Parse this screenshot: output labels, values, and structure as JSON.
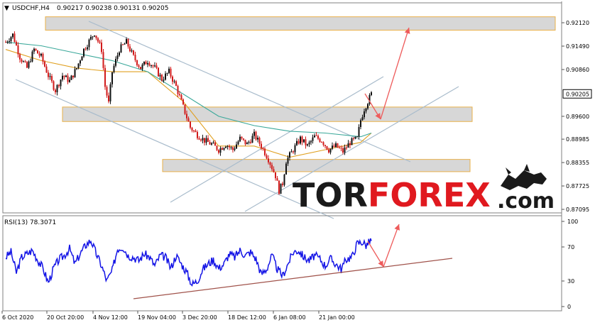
{
  "header": {
    "symbol": "USDCHF,H4",
    "ohlc": "0.90217 0.90238 0.90131 0.90205"
  },
  "watermark": {
    "part1": "TOR",
    "part2": "FOREX",
    "part3": ".com",
    "color_dark": "#1a1a1a",
    "color_red": "#e0191f"
  },
  "colors": {
    "candle_up": "#101010",
    "candle_down": "#d11a1a",
    "ma_fast": "#e0a020",
    "ma_slow": "#3aa89a",
    "zone_fill": "#d7d7d7",
    "zone_border": "#e8b04a",
    "channel": "#a9bccc",
    "arrow": "#ee5b5b",
    "rsi_line": "#1414e6",
    "rsi_trend": "#a0524a"
  },
  "chart_data": [
    {
      "type": "candlestick",
      "title": "USDCHF,H4",
      "y_ticks": [
        "0.92120",
        "0.91490",
        "0.90860",
        "0.90205",
        "0.89600",
        "0.88985",
        "0.88355",
        "0.87725",
        "0.87095"
      ],
      "current_price": "0.90205",
      "ylim": [
        0.87,
        0.9235
      ],
      "x_ticks": [
        "6 Oct 2020",
        "20 Oct 20:00",
        "4 Nov 12:00",
        "19 Nov 04:00",
        "3 Dec 20:00",
        "18 Dec 12:00",
        "6 Jan 08:00",
        "21 Jan 00:00"
      ],
      "approx_close_path": [
        [
          0,
          0.916
        ],
        [
          4,
          0.918
        ],
        [
          8,
          0.912
        ],
        [
          12,
          0.909
        ],
        [
          16,
          0.914
        ],
        [
          20,
          0.912
        ],
        [
          24,
          0.907
        ],
        [
          28,
          0.903
        ],
        [
          32,
          0.907
        ],
        [
          36,
          0.9055
        ],
        [
          40,
          0.909
        ],
        [
          44,
          0.914
        ],
        [
          48,
          0.917
        ],
        [
          50,
          0.9185
        ],
        [
          54,
          0.914
        ],
        [
          56,
          0.904
        ],
        [
          58,
          0.8995
        ],
        [
          60,
          0.908
        ],
        [
          64,
          0.914
        ],
        [
          68,
          0.916
        ],
        [
          72,
          0.912
        ],
        [
          76,
          0.909
        ],
        [
          80,
          0.911
        ],
        [
          84,
          0.909
        ],
        [
          88,
          0.906
        ],
        [
          92,
          0.908
        ],
        [
          96,
          0.904
        ],
        [
          100,
          0.8985
        ],
        [
          104,
          0.893
        ],
        [
          108,
          0.891
        ],
        [
          112,
          0.8895
        ],
        [
          116,
          0.8885
        ],
        [
          120,
          0.887
        ],
        [
          124,
          0.8885
        ],
        [
          128,
          0.887
        ],
        [
          132,
          0.89
        ],
        [
          136,
          0.8885
        ],
        [
          140,
          0.891
        ],
        [
          144,
          0.888
        ],
        [
          148,
          0.8845
        ],
        [
          152,
          0.88
        ],
        [
          154,
          0.876
        ],
        [
          156,
          0.878
        ],
        [
          158,
          0.884
        ],
        [
          162,
          0.887
        ],
        [
          166,
          0.89
        ],
        [
          170,
          0.888
        ],
        [
          174,
          0.8905
        ],
        [
          178,
          0.8895
        ],
        [
          182,
          0.887
        ],
        [
          186,
          0.888
        ],
        [
          190,
          0.8865
        ],
        [
          194,
          0.889
        ],
        [
          198,
          0.89
        ],
        [
          200,
          0.895
        ],
        [
          202,
          0.898
        ],
        [
          204,
          0.9
        ],
        [
          206,
          0.902
        ]
      ],
      "moving_averages": [
        {
          "path": [
            [
              0,
              0.914
            ],
            [
              20,
              0.911
            ],
            [
              40,
              0.909
            ],
            [
              60,
              0.908
            ],
            [
              80,
              0.908
            ],
            [
              100,
              0.9
            ],
            [
              120,
              0.888
            ],
            [
              140,
              0.888
            ],
            [
              160,
              0.885
            ],
            [
              180,
              0.887
            ],
            [
              200,
              0.889
            ],
            [
              206,
              0.8915
            ]
          ]
        },
        {
          "path": [
            [
              0,
              0.916
            ],
            [
              20,
              0.915
            ],
            [
              40,
              0.913
            ],
            [
              60,
              0.911
            ],
            [
              80,
              0.908
            ],
            [
              100,
              0.902
            ],
            [
              120,
              0.896
            ],
            [
              140,
              0.8935
            ],
            [
              160,
              0.892
            ],
            [
              180,
              0.8915
            ],
            [
              200,
              0.8905
            ],
            [
              206,
              0.8915
            ]
          ]
        }
      ],
      "zones": [
        {
          "range": [
            0.9192,
            0.9228
          ],
          "start": 26,
          "end": 320
        },
        {
          "range": [
            0.8945,
            0.8985
          ],
          "start": 35,
          "end": 270
        },
        {
          "range": [
            0.881,
            0.8845
          ],
          "start": 92,
          "end": 270
        }
      ]
    },
    {
      "type": "line",
      "title": "RSI(13) 78.3071",
      "y_ticks": [
        "100",
        "70",
        "30",
        "0"
      ],
      "ylim": [
        0,
        100
      ],
      "approx_path": [
        [
          0,
          58
        ],
        [
          3,
          64
        ],
        [
          6,
          40
        ],
        [
          9,
          58
        ],
        [
          12,
          62
        ],
        [
          15,
          66
        ],
        [
          18,
          55
        ],
        [
          21,
          45
        ],
        [
          24,
          28
        ],
        [
          27,
          45
        ],
        [
          30,
          55
        ],
        [
          33,
          60
        ],
        [
          36,
          68
        ],
        [
          39,
          50
        ],
        [
          42,
          62
        ],
        [
          45,
          72
        ],
        [
          48,
          78
        ],
        [
          51,
          62
        ],
        [
          54,
          48
        ],
        [
          57,
          30
        ],
        [
          60,
          42
        ],
        [
          63,
          68
        ],
        [
          66,
          70
        ],
        [
          69,
          60
        ],
        [
          72,
          58
        ],
        [
          75,
          54
        ],
        [
          78,
          62
        ],
        [
          81,
          58
        ],
        [
          84,
          48
        ],
        [
          87,
          60
        ],
        [
          90,
          58
        ],
        [
          93,
          45
        ],
        [
          96,
          60
        ],
        [
          99,
          50
        ],
        [
          102,
          40
        ],
        [
          105,
          26
        ],
        [
          108,
          30
        ],
        [
          111,
          44
        ],
        [
          114,
          50
        ],
        [
          117,
          55
        ],
        [
          120,
          45
        ],
        [
          123,
          50
        ],
        [
          126,
          62
        ],
        [
          129,
          58
        ],
        [
          132,
          66
        ],
        [
          135,
          60
        ],
        [
          138,
          64
        ],
        [
          141,
          56
        ],
        [
          144,
          38
        ],
        [
          147,
          44
        ],
        [
          150,
          60
        ],
        [
          153,
          44
        ],
        [
          156,
          36
        ],
        [
          159,
          50
        ],
        [
          162,
          64
        ],
        [
          165,
          66
        ],
        [
          168,
          58
        ],
        [
          171,
          54
        ],
        [
          174,
          60
        ],
        [
          177,
          56
        ],
        [
          180,
          48
        ],
        [
          183,
          56
        ],
        [
          186,
          50
        ],
        [
          189,
          44
        ],
        [
          192,
          56
        ],
        [
          195,
          58
        ],
        [
          198,
          74
        ],
        [
          201,
          76
        ],
        [
          203,
          72
        ],
        [
          206,
          78
        ]
      ]
    }
  ]
}
